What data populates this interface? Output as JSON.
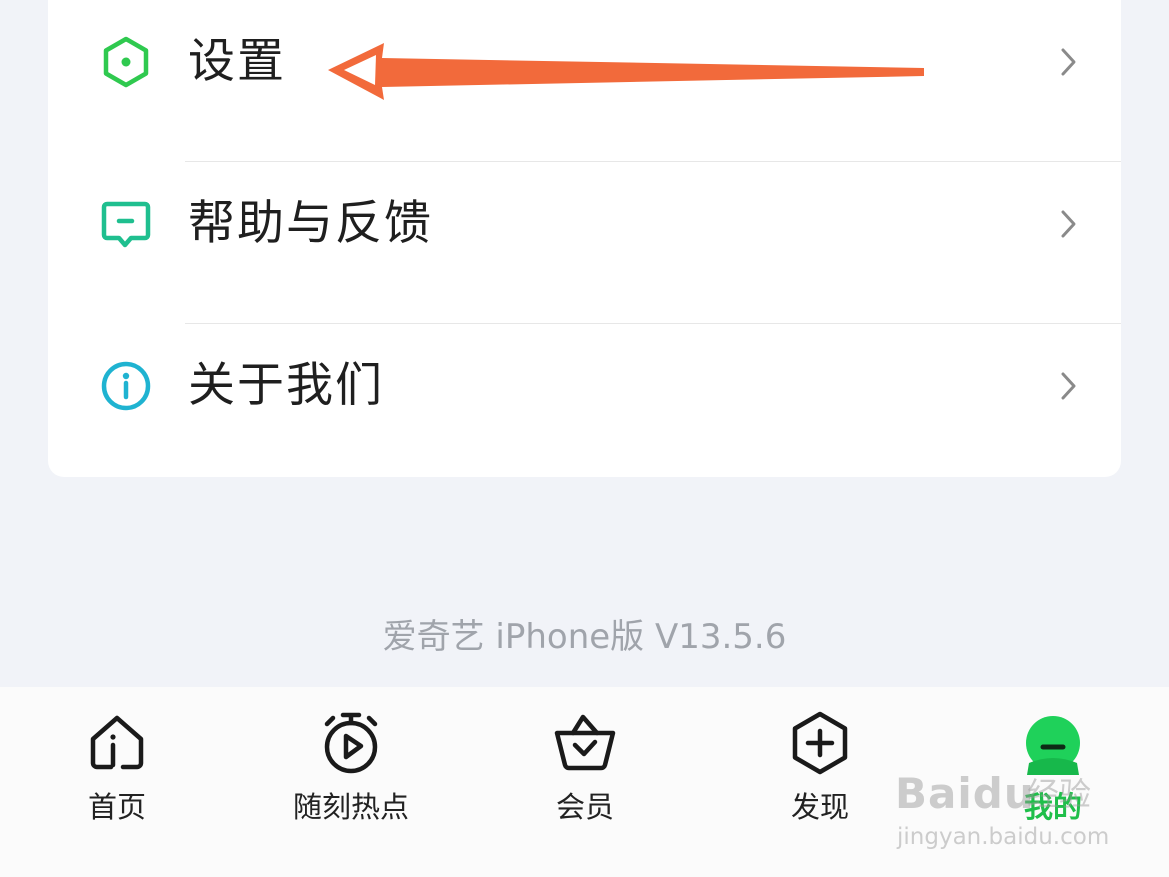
{
  "menu": {
    "items": [
      {
        "label": "设置",
        "icon": "settings-hexagon-icon",
        "icon_color": "#2fc94f"
      },
      {
        "label": "帮助与反馈",
        "icon": "feedback-chat-icon",
        "icon_color": "#1fbf8f"
      },
      {
        "label": "关于我们",
        "icon": "info-circle-icon",
        "icon_color": "#1fb3d1"
      }
    ]
  },
  "annotation": {
    "arrow_color": "#f26a3b"
  },
  "footer": {
    "version": "爱奇艺 iPhone版 V13.5.6"
  },
  "tab_bar": {
    "tabs": [
      {
        "label": "首页",
        "icon": "home-icon",
        "active": false
      },
      {
        "label": "随刻热点",
        "icon": "play-clock-icon",
        "active": false
      },
      {
        "label": "会员",
        "icon": "vip-basket-icon",
        "active": false
      },
      {
        "label": "发现",
        "icon": "discover-plus-icon",
        "active": false
      },
      {
        "label": "我的",
        "icon": "profile-icon",
        "active": true
      }
    ],
    "active_color": "#1fbf4a"
  },
  "watermark": {
    "brand": "Baidu",
    "sub": "经验",
    "url": "jingyan.baidu.com"
  }
}
